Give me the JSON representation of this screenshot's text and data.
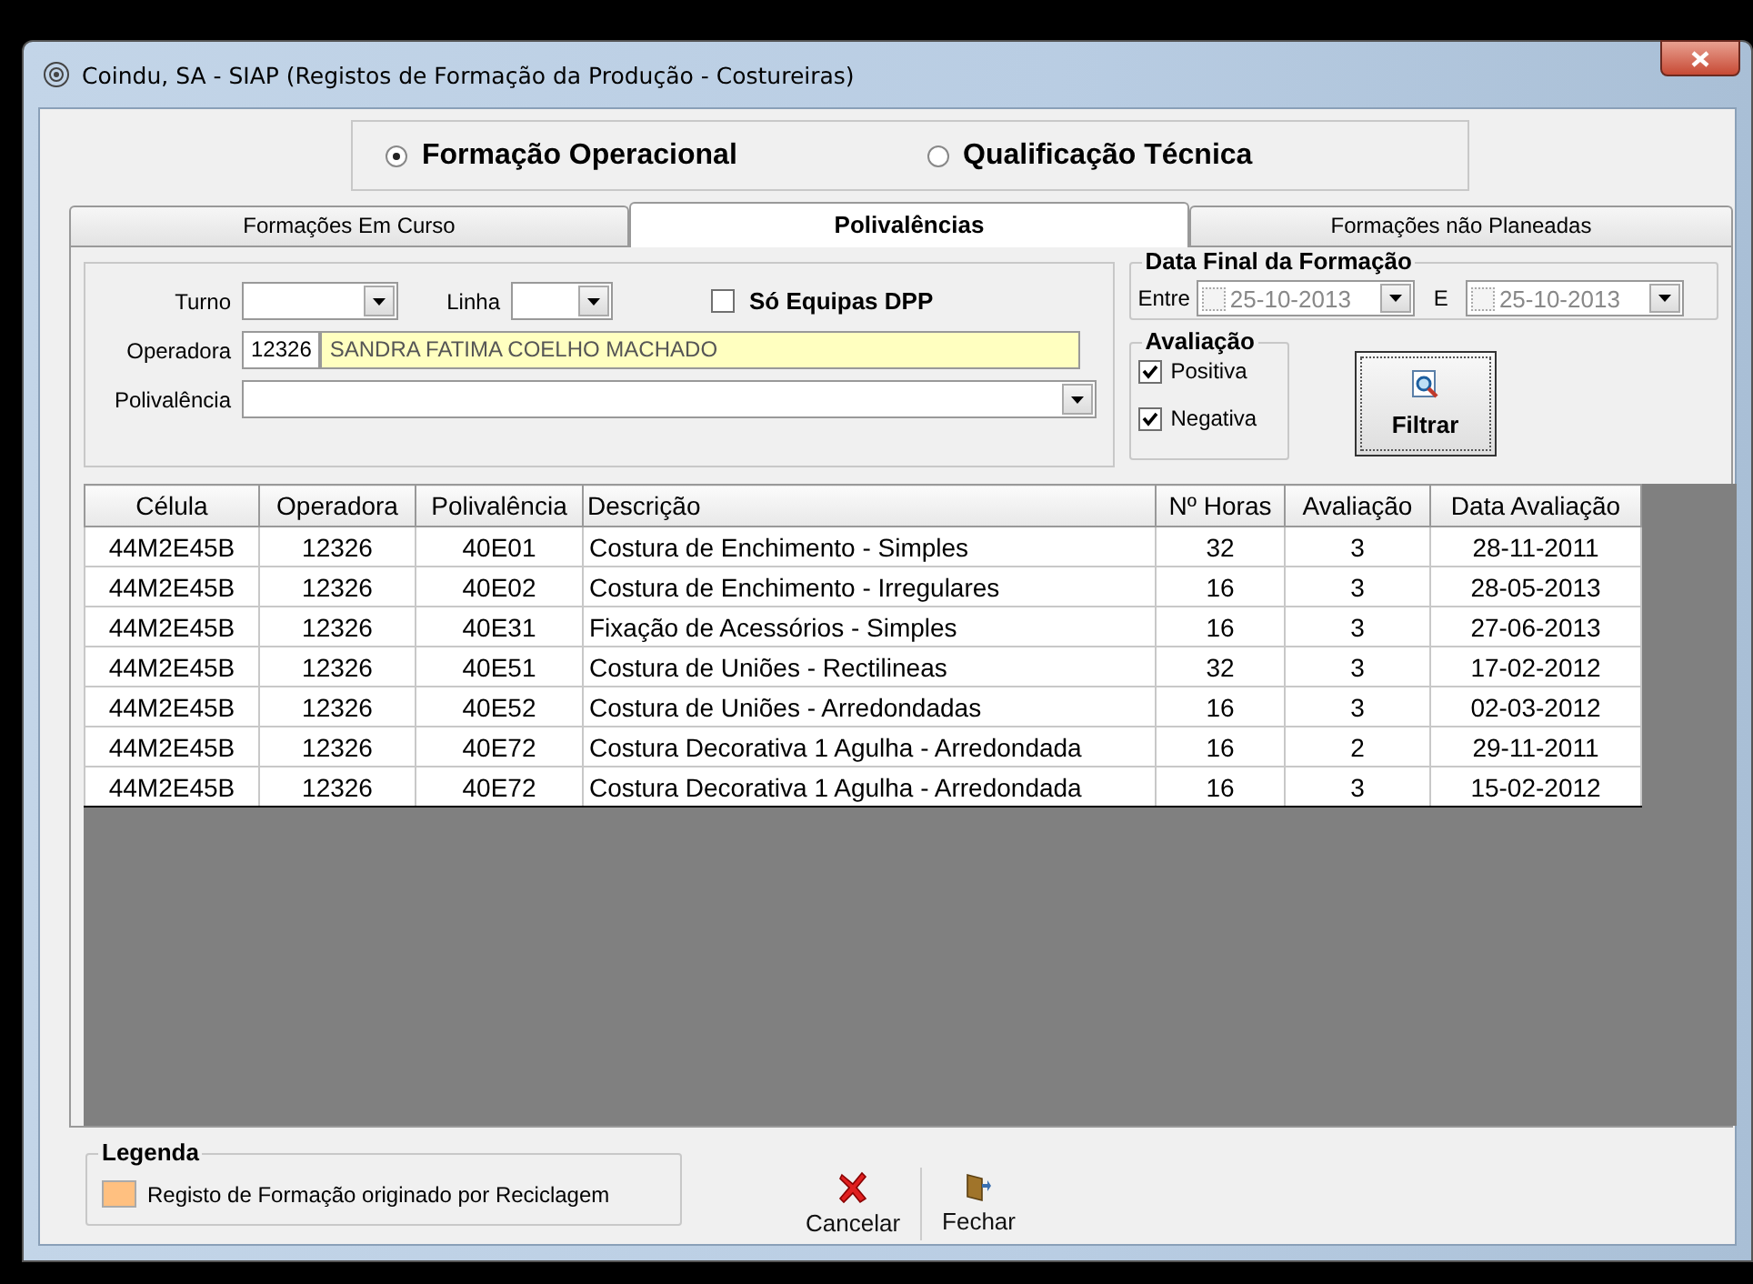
{
  "window": {
    "title": "Coindu, SA - SIAP (Registos de Formação da Produção - Costureiras)"
  },
  "mode_options": [
    {
      "label": "Formação Operacional",
      "selected": true
    },
    {
      "label": "Qualificação Técnica",
      "selected": false
    }
  ],
  "tabs": [
    {
      "label": "Formações Em Curso",
      "selected": false
    },
    {
      "label": "Polivalências",
      "selected": true
    },
    {
      "label": "Formações não Planeadas",
      "selected": false
    }
  ],
  "filters": {
    "turno": {
      "label": "Turno"
    },
    "linha": {
      "label": "Linha"
    },
    "so_equipas": {
      "label": "Só Equipas DPP",
      "checked": false
    },
    "operadora": {
      "label": "Operadora",
      "code": "12326",
      "name": "SANDRA FATIMA COELHO MACHADO"
    },
    "polivalencia": {
      "label": "Polivalência"
    }
  },
  "date_filter": {
    "title": "Data Final da Formação",
    "from_label": "Entre",
    "from": {
      "value": "25-10-2013",
      "checked": false
    },
    "to_label": "E",
    "to": {
      "value": "25-10-2013",
      "checked": false
    }
  },
  "evaluation": {
    "title": "Avaliação",
    "options": [
      {
        "label": "Positiva",
        "checked": true
      },
      {
        "label": "Negativa",
        "checked": true
      }
    ]
  },
  "filter_button": {
    "label": "Filtrar"
  },
  "table": {
    "columns": [
      "Célula",
      "Operadora",
      "Polivalência",
      "Descrição",
      "Nº Horas",
      "Avaliação",
      "Data Avaliação"
    ],
    "rows": [
      [
        "44M2E45B",
        "12326",
        "40E01",
        "Costura de Enchimento - Simples",
        "32",
        "3",
        "28-11-2011"
      ],
      [
        "44M2E45B",
        "12326",
        "40E02",
        "Costura de Enchimento - Irregulares",
        "16",
        "3",
        "28-05-2013"
      ],
      [
        "44M2E45B",
        "12326",
        "40E31",
        "Fixação de Acessórios - Simples",
        "16",
        "3",
        "27-06-2013"
      ],
      [
        "44M2E45B",
        "12326",
        "40E51",
        "Costura de Uniões - Rectilineas",
        "32",
        "3",
        "17-02-2012"
      ],
      [
        "44M2E45B",
        "12326",
        "40E52",
        "Costura de Uniões - Arredondadas",
        "16",
        "3",
        "02-03-2012"
      ],
      [
        "44M2E45B",
        "12326",
        "40E72",
        "Costura Decorativa 1 Agulha - Arredondada",
        "16",
        "2",
        "29-11-2011"
      ],
      [
        "44M2E45B",
        "12326",
        "40E72",
        "Costura Decorativa 1 Agulha - Arredondada",
        "16",
        "3",
        "15-02-2012"
      ]
    ]
  },
  "legend": {
    "title": "Legenda",
    "items": [
      {
        "label": "Registo de Formação originado por Reciclagem",
        "color": "#ffc080"
      }
    ]
  },
  "buttons": [
    {
      "label": "Cancelar",
      "kind": "cancel"
    },
    {
      "label": "Fechar",
      "kind": "close"
    }
  ]
}
